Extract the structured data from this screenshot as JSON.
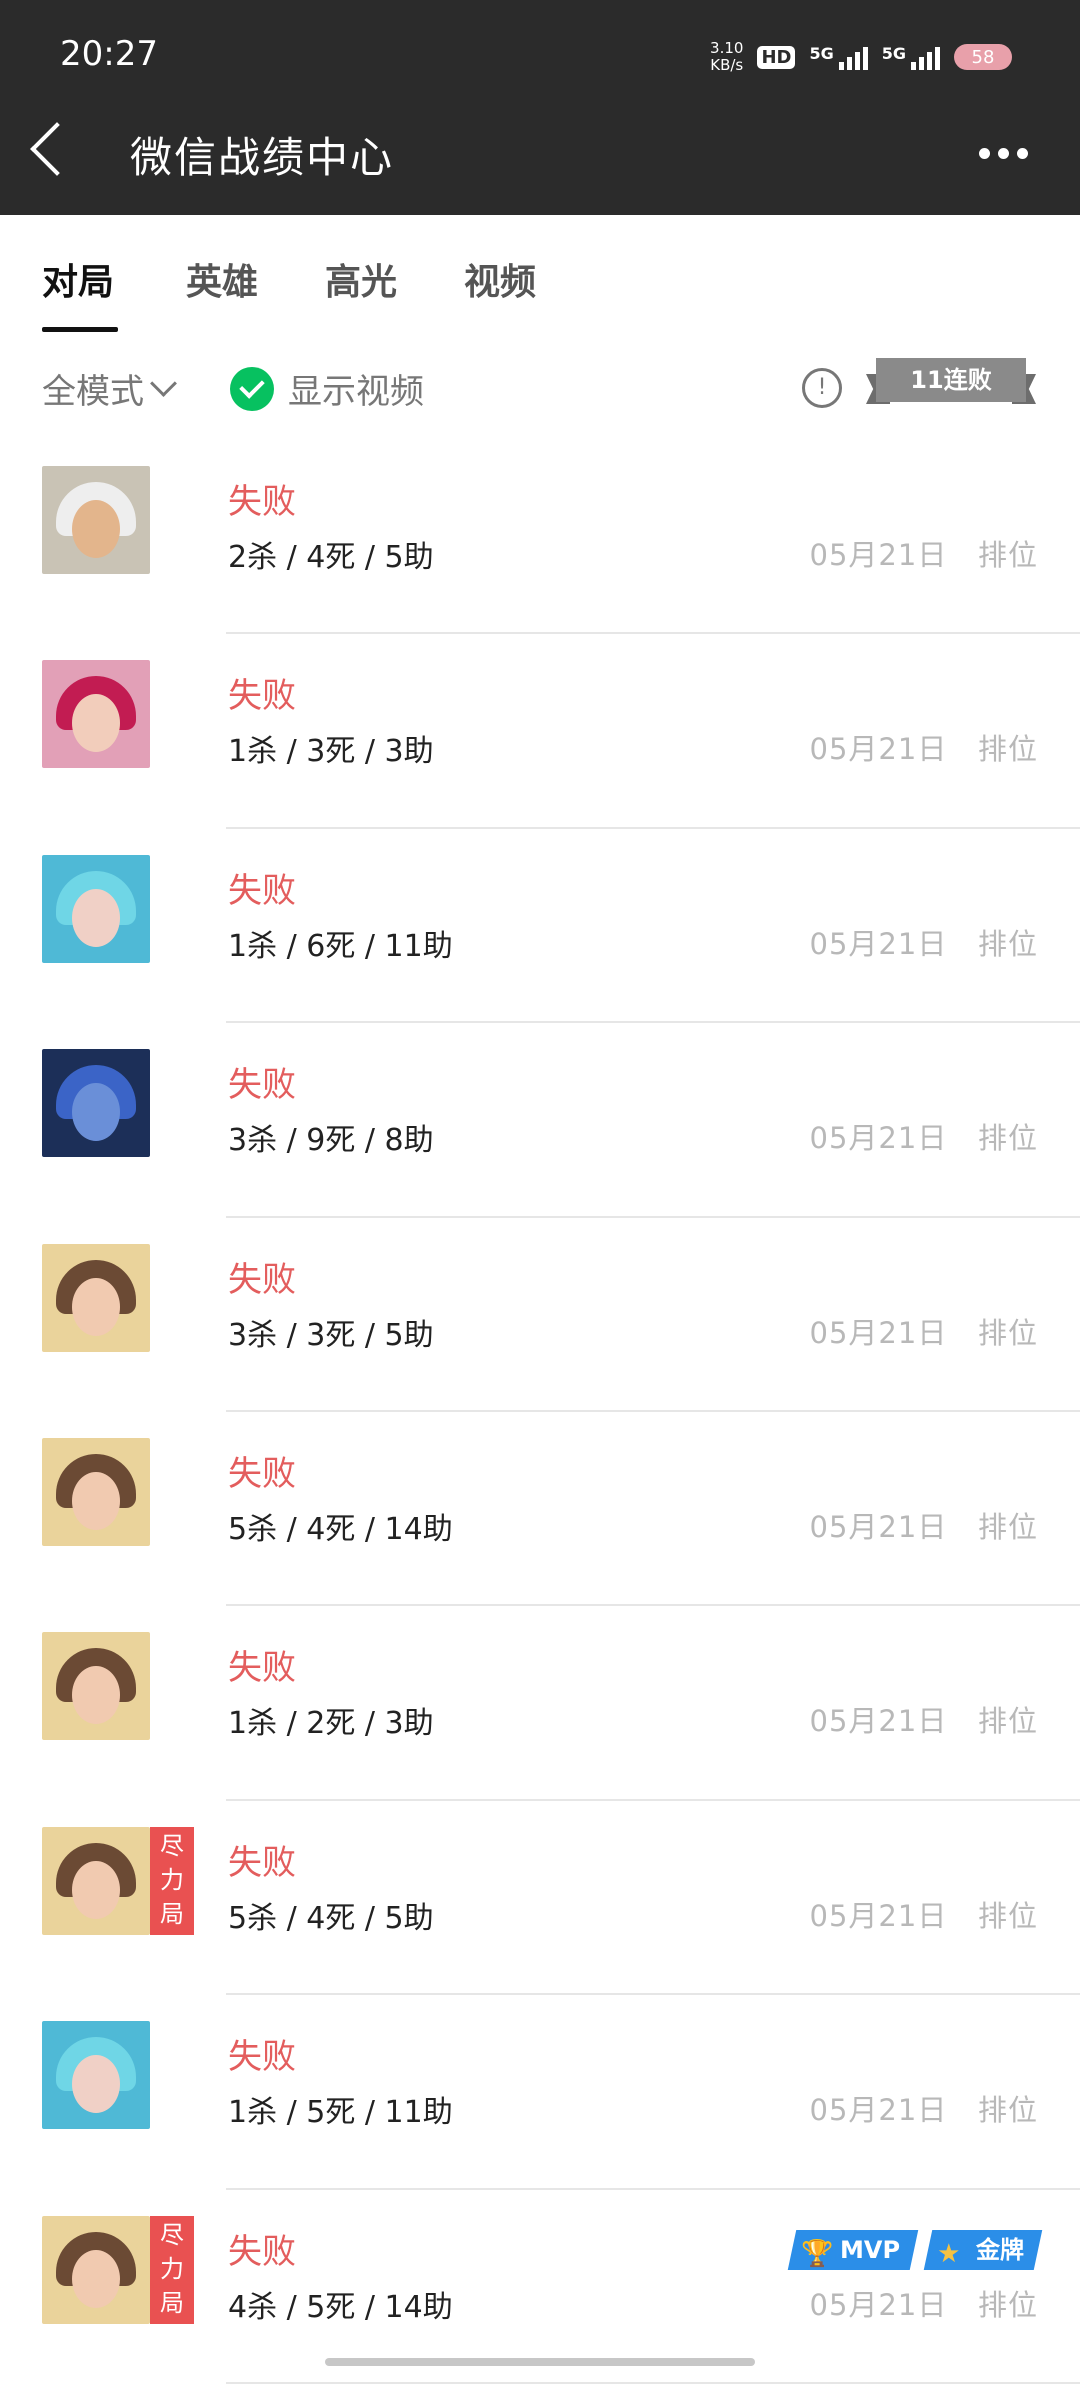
{
  "status_bar": {
    "time": "20:27",
    "net_speed": "3.10",
    "net_unit": "KB/s",
    "hd": "HD",
    "sim1": "5G",
    "sim2": "5G",
    "battery": "58"
  },
  "header": {
    "title": "微信战绩中心",
    "back_icon": "back-arrow-icon",
    "more_icon": "more-dots-icon"
  },
  "tabs": [
    {
      "label": "对局",
      "active": true
    },
    {
      "label": "英雄",
      "active": false
    },
    {
      "label": "高光",
      "active": false
    },
    {
      "label": "视频",
      "active": false
    }
  ],
  "filter": {
    "mode": "全模式",
    "show_video": "显示视频",
    "show_video_checked": true,
    "info_icon": "!",
    "streak": "11连败"
  },
  "matches": [
    {
      "result": "失败",
      "kda": "2杀 / 4死 / 5助",
      "date": "05月21日",
      "mode": "排位",
      "hero": "hero-a",
      "tag": "",
      "badges": []
    },
    {
      "result": "失败",
      "kda": "1杀 / 3死 / 3助",
      "date": "05月21日",
      "mode": "排位",
      "hero": "hero-b",
      "tag": "",
      "badges": []
    },
    {
      "result": "失败",
      "kda": "1杀 / 6死 / 11助",
      "date": "05月21日",
      "mode": "排位",
      "hero": "hero-c",
      "tag": "",
      "badges": []
    },
    {
      "result": "失败",
      "kda": "3杀 / 9死 / 8助",
      "date": "05月21日",
      "mode": "排位",
      "hero": "hero-d",
      "tag": "",
      "badges": []
    },
    {
      "result": "失败",
      "kda": "3杀 / 3死 / 5助",
      "date": "05月21日",
      "mode": "排位",
      "hero": "hero-e",
      "tag": "",
      "badges": []
    },
    {
      "result": "失败",
      "kda": "5杀 / 4死 / 14助",
      "date": "05月21日",
      "mode": "排位",
      "hero": "hero-e",
      "tag": "",
      "badges": []
    },
    {
      "result": "失败",
      "kda": "1杀 / 2死 / 3助",
      "date": "05月21日",
      "mode": "排位",
      "hero": "hero-e",
      "tag": "",
      "badges": []
    },
    {
      "result": "失败",
      "kda": "5杀 / 4死 / 5助",
      "date": "05月21日",
      "mode": "排位",
      "hero": "hero-e",
      "tag": "尽力局",
      "badges": []
    },
    {
      "result": "失败",
      "kda": "1杀 / 5死 / 11助",
      "date": "05月21日",
      "mode": "排位",
      "hero": "hero-c",
      "tag": "",
      "badges": []
    },
    {
      "result": "失败",
      "kda": "4杀 / 5死 / 14助",
      "date": "05月21日",
      "mode": "排位",
      "hero": "hero-e",
      "tag": "尽力局",
      "badges": [
        "MVP",
        "金牌"
      ]
    }
  ],
  "colors": {
    "header_bg": "#2b2b2b",
    "loss_red": "#e35d5d",
    "check_green": "#07c160",
    "tag_red": "#e95151",
    "badge_blue": "#2b8ee8"
  }
}
